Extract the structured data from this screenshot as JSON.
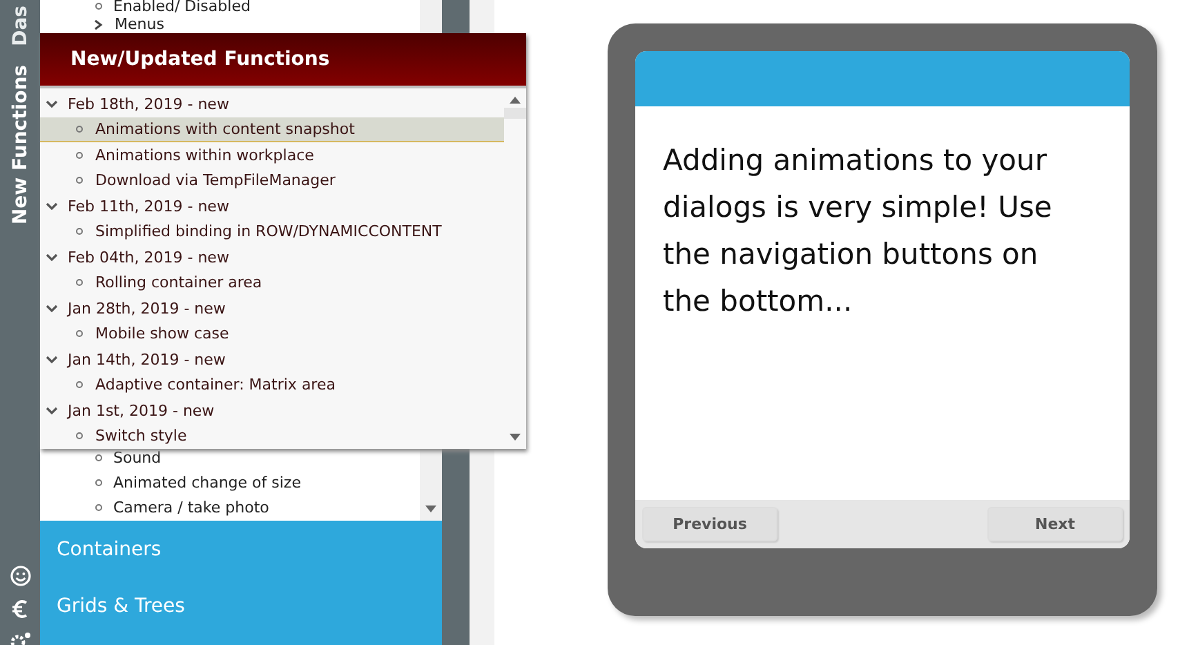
{
  "sidebar": {
    "tabs": [
      {
        "label": "Das",
        "selected": false
      },
      {
        "label": "New Functions",
        "selected": true
      }
    ]
  },
  "list": {
    "items": [
      {
        "label": "Enabled/ Disabled",
        "kind": "leaf"
      },
      {
        "label": "Menus",
        "kind": "group"
      }
    ],
    "items_below": [
      {
        "label": "Sound",
        "kind": "leaf"
      },
      {
        "label": "Animated change of size",
        "kind": "leaf"
      },
      {
        "label": "Camera / take photo",
        "kind": "leaf"
      }
    ]
  },
  "sections": [
    "Containers",
    "Grids & Trees"
  ],
  "popup": {
    "title": "New/Updated Functions",
    "groups": [
      {
        "label": "Feb 18th, 2019 - new",
        "expanded": true,
        "children": [
          {
            "label": "Animations with content snapshot",
            "selected": true
          },
          {
            "label": "Animations within workplace",
            "selected": false
          },
          {
            "label": "Download via TempFileManager",
            "selected": false
          }
        ]
      },
      {
        "label": "Feb 11th, 2019 - new",
        "expanded": true,
        "children": [
          {
            "label": "Simplified binding in ROW/DYNAMICCONTENT",
            "selected": false
          }
        ]
      },
      {
        "label": "Feb 04th, 2019 - new",
        "expanded": true,
        "children": [
          {
            "label": "Rolling container area",
            "selected": false
          }
        ]
      },
      {
        "label": "Jan 28th, 2019 - new",
        "expanded": true,
        "children": [
          {
            "label": "Mobile show case",
            "selected": false
          }
        ]
      },
      {
        "label": "Jan 14th, 2019 - new",
        "expanded": true,
        "children": [
          {
            "label": "Adaptive container: Matrix area",
            "selected": false
          }
        ]
      },
      {
        "label": "Jan 1st, 2019 - new",
        "expanded": true,
        "children": [
          {
            "label": "Switch style",
            "selected": false
          }
        ]
      }
    ]
  },
  "phone": {
    "message": "Adding animations to your dialogs is very simple! Use the navigation buttons on the bottom...",
    "buttons": [
      "Previous",
      "Next"
    ]
  }
}
